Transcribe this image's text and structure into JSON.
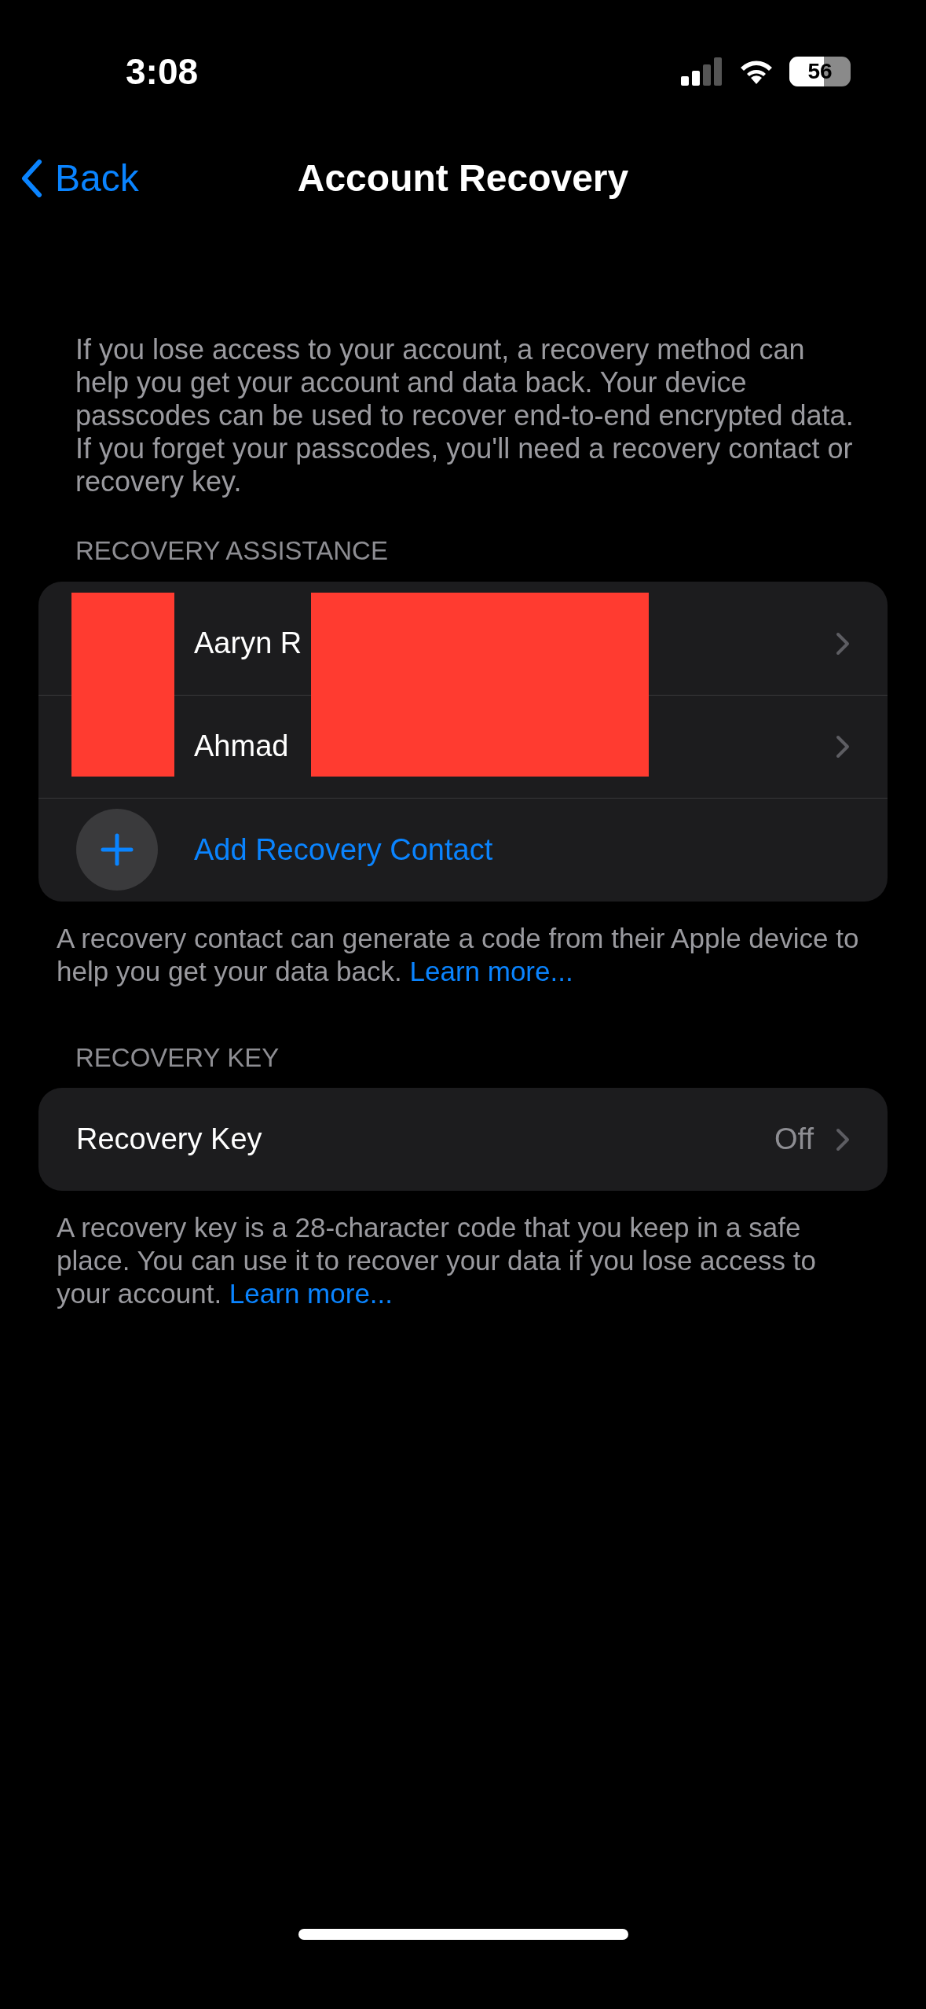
{
  "status_bar": {
    "time": "3:08",
    "battery": "56"
  },
  "nav": {
    "back": "Back",
    "title": "Account Recovery"
  },
  "intro": "If you lose access to your account, a recovery method can help you get your account and data back. Your device passcodes can be used to recover end-to-end encrypted data. If you forget your passcodes, you'll need a recovery contact or recovery key.",
  "recovery_assistance": {
    "header": "RECOVERY ASSISTANCE",
    "contacts": [
      {
        "name": "Aaryn R"
      },
      {
        "name": "Ahmad"
      }
    ],
    "add_label": "Add Recovery Contact",
    "footer": "A recovery contact can generate a code from their Apple device to help you get your data back.",
    "footer_link": "Learn more..."
  },
  "recovery_key": {
    "header": "RECOVERY KEY",
    "label": "Recovery Key",
    "value": "Off",
    "footer": "A recovery key is a 28-character code that you keep in a safe place. You can use it to recover your data if you lose access to your account.",
    "footer_link": "Learn more..."
  }
}
